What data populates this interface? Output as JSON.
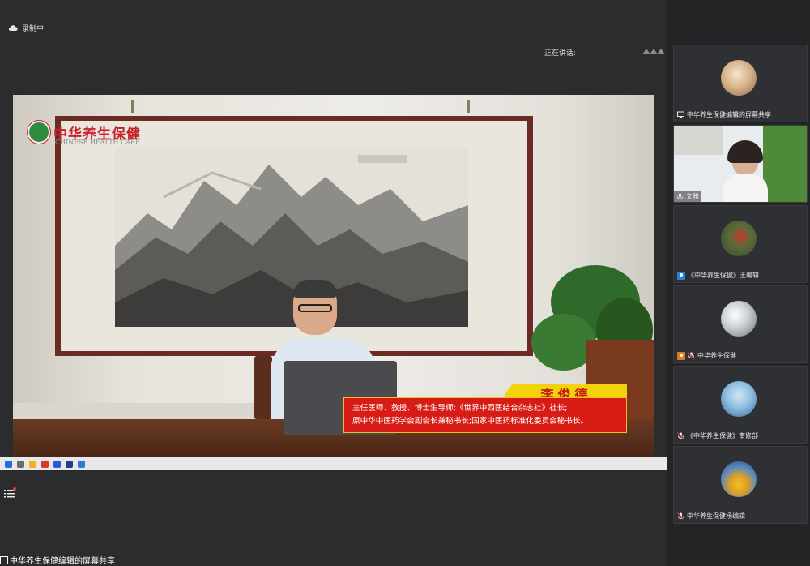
{
  "topbar": {
    "recording_label": "录制中",
    "speaking_label": "正在讲话:"
  },
  "video": {
    "logo": {
      "cn": "中华养生保健",
      "en": "CHINESE HEALTH CARE"
    },
    "speaker": {
      "name": "李俊德",
      "titles": [
        "主任医师、教授、博士生导师;《世界中西医结合杂志社》社长;",
        "原中华中医药学会副会长兼秘书长;国家中医药标准化委员会秘书长。"
      ]
    }
  },
  "participants": [
    {
      "label": "中华养生保健编辑的屏幕共享",
      "icon": "screen-share-icon",
      "avatar": "pink"
    },
    {
      "label": "文雅",
      "icon": "microphone-icon",
      "avatar": "video"
    },
    {
      "label": "《中华养生保健》王编辑",
      "icon": "user-avatar-icon",
      "avatar": "soldier"
    },
    {
      "label": "中华养生保健",
      "icon": "microphone-muted-icon",
      "avatar": "bird"
    },
    {
      "label": "《中华养生保健》审修部",
      "icon": "microphone-muted-icon",
      "avatar": "blue"
    },
    {
      "label": "中华养生保健杨编辑",
      "icon": "microphone-muted-icon",
      "avatar": "yellow"
    }
  ],
  "bottom": {
    "share_label": "中华养生保健编辑的屏幕共享"
  },
  "colors": {
    "background": "#2b2c2e",
    "caption_red": "#d61c14",
    "caption_yellow": "#f2d20a"
  }
}
